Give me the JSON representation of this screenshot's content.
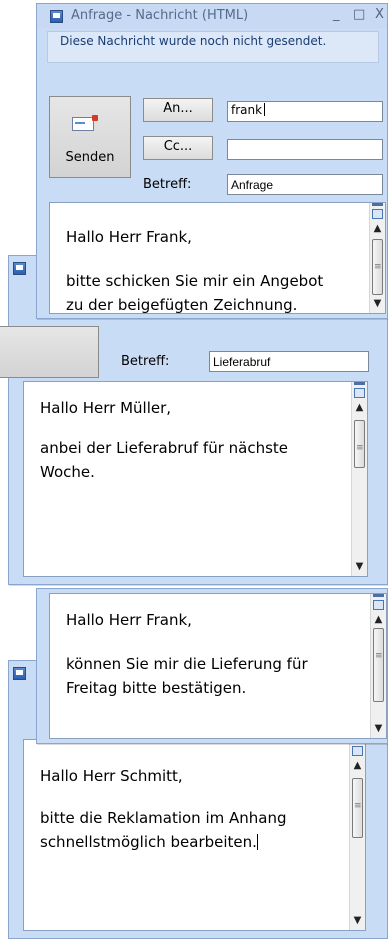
{
  "w1": {
    "title": "Anfrage - Nachricht (HTML)",
    "controls": {
      "minimize": "_",
      "maximize": "□",
      "close": "X"
    },
    "info": "Diese Nachricht wurde noch nicht gesendet.",
    "send": "Senden",
    "to_btn": "An...",
    "cc_btn": "Cc...",
    "subject_label": "Betreff:",
    "to": "frank",
    "cc": "",
    "subject": "Anfrage",
    "body": [
      "Hallo Herr Frank,",
      "bitte schicken Sie mir ein Angebot",
      "zu der beigefügten Zeichnung."
    ]
  },
  "w2": {
    "subject_label": "Betreff:",
    "subject": "Lieferabruf",
    "body": [
      "Hallo Herr Müller,",
      "anbei der Lieferabruf für nächste",
      "Woche."
    ]
  },
  "w3": {
    "body": [
      "Hallo Herr Frank,",
      "können Sie mir die Lieferung für",
      "Freitag bitte bestätigen."
    ]
  },
  "w4": {
    "body": [
      "Hallo Herr Schmitt,",
      "bitte die Reklamation im Anhang",
      "schnellstmöglich bearbeiten."
    ]
  }
}
